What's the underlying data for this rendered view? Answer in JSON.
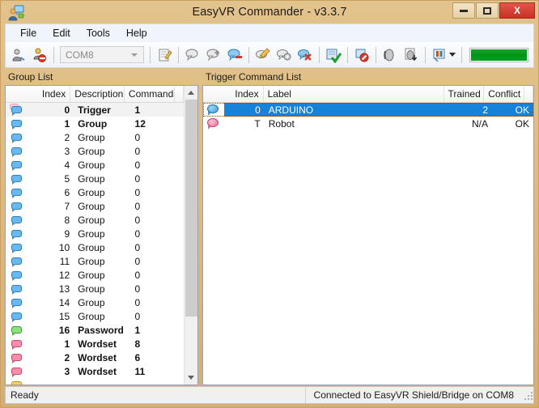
{
  "window": {
    "title": "EasyVR Commander - v3.3.7",
    "app_icon": "speech-person-icon",
    "minimize_label": "",
    "maximize_label": "",
    "close_label": "X"
  },
  "menu": {
    "items": [
      {
        "label": "File"
      },
      {
        "label": "Edit"
      },
      {
        "label": "Tools"
      },
      {
        "label": "Help"
      }
    ]
  },
  "toolbar": {
    "com_port": "COM8",
    "buttons": [
      {
        "name": "connect-icon"
      },
      {
        "name": "disconnect-icon"
      },
      {
        "name": "edit-note-icon"
      },
      {
        "name": "add-command-icon"
      },
      {
        "name": "insert-command-icon"
      },
      {
        "name": "remove-command-icon"
      },
      {
        "name": "rename-command-icon"
      },
      {
        "name": "command-settings-icon"
      },
      {
        "name": "delete-command-icon"
      },
      {
        "name": "train-command-icon"
      },
      {
        "name": "erase-training-icon"
      },
      {
        "name": "test-sound-icon"
      },
      {
        "name": "download-sound-icon"
      },
      {
        "name": "generate-code-icon"
      }
    ],
    "progress_percent": 100,
    "progress_color": "#0d9b21"
  },
  "left_panel": {
    "label": "Group List",
    "columns": [
      {
        "key": "icon",
        "label": ""
      },
      {
        "key": "index",
        "label": "Index"
      },
      {
        "key": "description",
        "label": "Description"
      },
      {
        "key": "commands",
        "label": "Commands"
      },
      {
        "key": "spacer",
        "label": ""
      }
    ],
    "rows": [
      {
        "icon": "trigger-bubble-icon",
        "icon_color": "blue",
        "ghost": true,
        "index": "0",
        "description": "Trigger",
        "commands": "1",
        "bold": true,
        "selected_soft": true
      },
      {
        "icon": "group-bubble-icon",
        "icon_color": "blue",
        "index": "1",
        "description": "Group",
        "commands": "12",
        "bold": true
      },
      {
        "icon": "group-bubble-icon",
        "icon_color": "blue",
        "index": "2",
        "description": "Group",
        "commands": "0"
      },
      {
        "icon": "group-bubble-icon",
        "icon_color": "blue",
        "index": "3",
        "description": "Group",
        "commands": "0"
      },
      {
        "icon": "group-bubble-icon",
        "icon_color": "blue",
        "index": "4",
        "description": "Group",
        "commands": "0"
      },
      {
        "icon": "group-bubble-icon",
        "icon_color": "blue",
        "index": "5",
        "description": "Group",
        "commands": "0"
      },
      {
        "icon": "group-bubble-icon",
        "icon_color": "blue",
        "index": "6",
        "description": "Group",
        "commands": "0"
      },
      {
        "icon": "group-bubble-icon",
        "icon_color": "blue",
        "index": "7",
        "description": "Group",
        "commands": "0"
      },
      {
        "icon": "group-bubble-icon",
        "icon_color": "blue",
        "index": "8",
        "description": "Group",
        "commands": "0"
      },
      {
        "icon": "group-bubble-icon",
        "icon_color": "blue",
        "index": "9",
        "description": "Group",
        "commands": "0"
      },
      {
        "icon": "group-bubble-icon",
        "icon_color": "blue",
        "index": "10",
        "description": "Group",
        "commands": "0"
      },
      {
        "icon": "group-bubble-icon",
        "icon_color": "blue",
        "index": "11",
        "description": "Group",
        "commands": "0"
      },
      {
        "icon": "group-bubble-icon",
        "icon_color": "blue",
        "index": "12",
        "description": "Group",
        "commands": "0"
      },
      {
        "icon": "group-bubble-icon",
        "icon_color": "blue",
        "index": "13",
        "description": "Group",
        "commands": "0"
      },
      {
        "icon": "group-bubble-icon",
        "icon_color": "blue",
        "index": "14",
        "description": "Group",
        "commands": "0"
      },
      {
        "icon": "group-bubble-icon",
        "icon_color": "blue",
        "index": "15",
        "description": "Group",
        "commands": "0"
      },
      {
        "icon": "password-bubble-icon",
        "icon_color": "green",
        "index": "16",
        "description": "Password",
        "commands": "1",
        "bold": true
      },
      {
        "icon": "wordset-bubble-icon",
        "icon_color": "pink",
        "index": "1",
        "description": "Wordset",
        "commands": "8",
        "bold": true
      },
      {
        "icon": "wordset-bubble-icon",
        "icon_color": "pink",
        "index": "2",
        "description": "Wordset",
        "commands": "6",
        "bold": true
      },
      {
        "icon": "wordset-bubble-icon",
        "icon_color": "pink",
        "index": "3",
        "description": "Wordset",
        "commands": "11",
        "bold": true
      },
      {
        "icon": "grammar-folder-icon",
        "icon_color": "yellow",
        "index": "",
        "description": "",
        "commands": "",
        "bold": true
      }
    ],
    "scrollbar": {
      "up_arrow": "chevron-up-icon",
      "down_arrow": "chevron-down-icon",
      "thumb_percent": 88
    }
  },
  "right_panel": {
    "label": "Trigger Command List",
    "columns": [
      {
        "key": "icon",
        "label": ""
      },
      {
        "key": "index",
        "label": "Index"
      },
      {
        "key": "label",
        "label": "Label"
      },
      {
        "key": "trained",
        "label": "Trained"
      },
      {
        "key": "conflict",
        "label": "Conflict"
      },
      {
        "key": "spacer",
        "label": ""
      }
    ],
    "rows": [
      {
        "icon": "command-bubble-icon",
        "icon_color": "blue",
        "index": "0",
        "label": "ARDUINO",
        "trained": "2",
        "conflict": "OK",
        "selected": true
      },
      {
        "icon": "trigger-bubble-icon",
        "icon_color": "pink",
        "index": "T",
        "label": "Robot",
        "trained": "N/A",
        "conflict": "OK",
        "selected": false
      }
    ],
    "selection_color": "#1683d8"
  },
  "statusbar": {
    "left_text": "Ready",
    "right_text": "Connected to EasyVR Shield/Bridge on COM8"
  }
}
